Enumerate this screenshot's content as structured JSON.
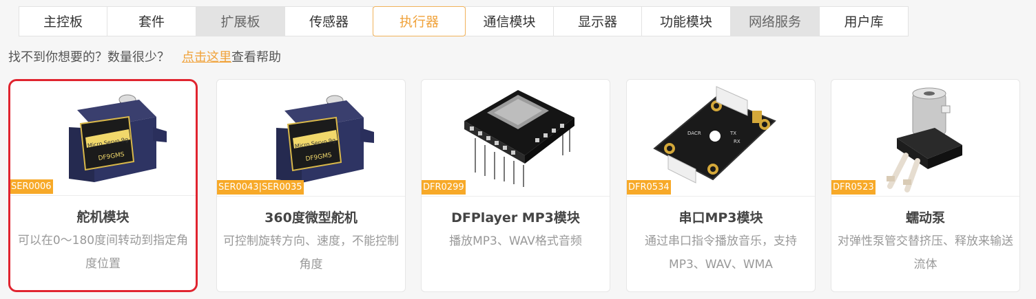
{
  "tabs": [
    {
      "label": "主控板"
    },
    {
      "label": "套件"
    },
    {
      "label": "扩展板"
    },
    {
      "label": "传感器"
    },
    {
      "label": "执行器"
    },
    {
      "label": "通信模块"
    },
    {
      "label": "显示器"
    },
    {
      "label": "功能模块"
    },
    {
      "label": "网络服务"
    },
    {
      "label": "用户库"
    }
  ],
  "help": {
    "text": "找不到你想要的？数量很少？",
    "link": "点击这里",
    "suffix": "查看帮助"
  },
  "products": [
    {
      "sku": "SER0006",
      "title": "舵机模块",
      "desc": "可以在0～180度间转动到指定角度位置",
      "image": "servo-image"
    },
    {
      "sku": "SER0043|SER0035",
      "title": "360度微型舵机",
      "desc": "可控制旋转方向、速度，不能控制角度",
      "image": "servo-image"
    },
    {
      "sku": "DFR0299",
      "title": "DFPlayer MP3模块",
      "desc": "播放MP3、WAV格式音频",
      "image": "mp3-board-image"
    },
    {
      "sku": "DFR0534",
      "title": "串口MP3模块",
      "desc": "通过串口指令播放音乐，支持MP3、WAV、WMA",
      "image": "serial-mp3-board-image"
    },
    {
      "sku": "DFR0523",
      "title": "蠕动泵",
      "desc": "对弹性泵管交替挤压、释放来输送流体",
      "image": "pump-image"
    }
  ],
  "colors": {
    "accent": "#f0a23a",
    "selected_border": "#e0242f",
    "sku_bg": "#f7a928"
  }
}
